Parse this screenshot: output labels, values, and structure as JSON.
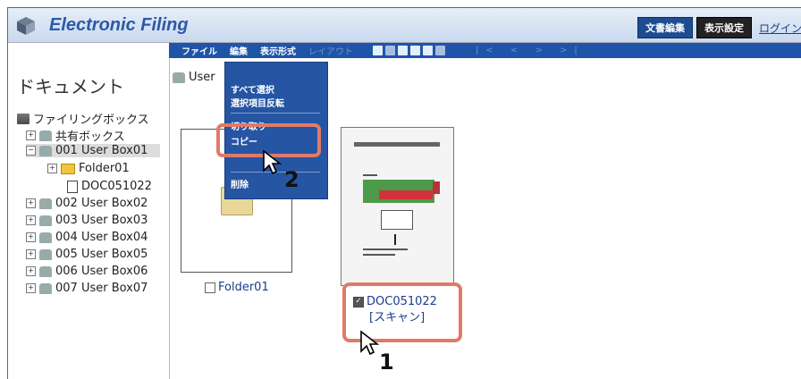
{
  "header": {
    "title": "Electronic Filing",
    "buttons": [
      "文書編集",
      "表示設定"
    ],
    "link": "ログイン"
  },
  "menubar": {
    "items": [
      "ファイル",
      "編集",
      "表示形式"
    ],
    "disabled_item": "レイアウト",
    "nav": "|< < > >|"
  },
  "tree": {
    "title": "ドキュメント",
    "root": "ファイリングボックス",
    "shared": "共有ボックス",
    "selected_box": "001 User Box01",
    "folder": "Folder01",
    "doc": "DOC051022",
    "boxes": [
      "002 User Box02",
      "003 User Box03",
      "004 User Box04",
      "005 User Box05",
      "006 User Box06",
      "007 User Box07"
    ]
  },
  "main": {
    "crumb": "User",
    "folder_label": "Folder01",
    "doc_name": "DOC051022",
    "doc_type": "[スキャン]"
  },
  "context_menu": {
    "select_all": "すべて選択",
    "invert": "選択項目反転",
    "partial": "切り取り",
    "copy": "コピー",
    "delete": "削除"
  },
  "steps": [
    "1",
    "2"
  ],
  "colors": {
    "accent": "#1f55a8",
    "highlight": "#e07a68"
  }
}
